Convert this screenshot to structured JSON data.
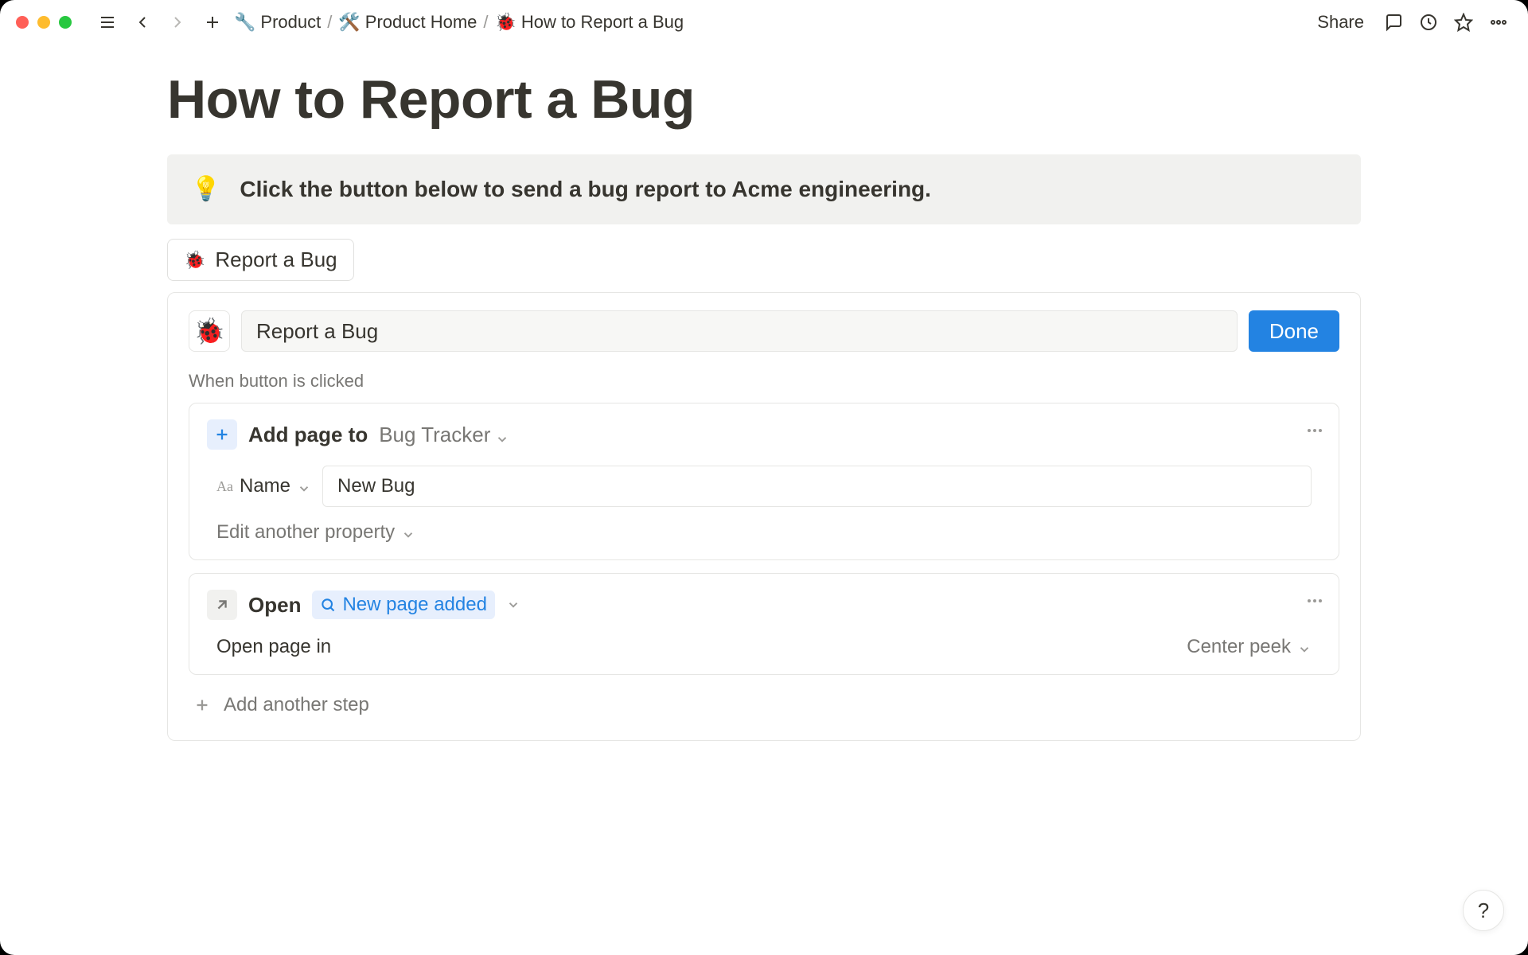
{
  "breadcrumb": {
    "item1_icon": "🔧",
    "item1_label": "Product",
    "item2_icon": "🛠️",
    "item2_label": "Product Home",
    "item3_icon": "🐞",
    "item3_label": "How to Report a Bug"
  },
  "topbar": {
    "share_label": "Share"
  },
  "page": {
    "title": "How to Report a Bug",
    "callout_icon": "💡",
    "callout_text": "Click the button below to send a bug report to Acme engineering.",
    "button_icon": "🐞",
    "button_label": "Report a Bug"
  },
  "config": {
    "icon": "🐞",
    "name_value": "Report a Bug",
    "done_label": "Done",
    "trigger_label": "When button is clicked",
    "step1": {
      "title": "Add page to",
      "target": "Bug Tracker",
      "prop_name_label": "Name",
      "prop_name_value": "New Bug",
      "edit_another_label": "Edit another property"
    },
    "step2": {
      "title": "Open",
      "pill_label": "New page added",
      "open_in_label": "Open page in",
      "open_mode": "Center peek"
    },
    "add_step_label": "Add another step"
  },
  "help_label": "?"
}
